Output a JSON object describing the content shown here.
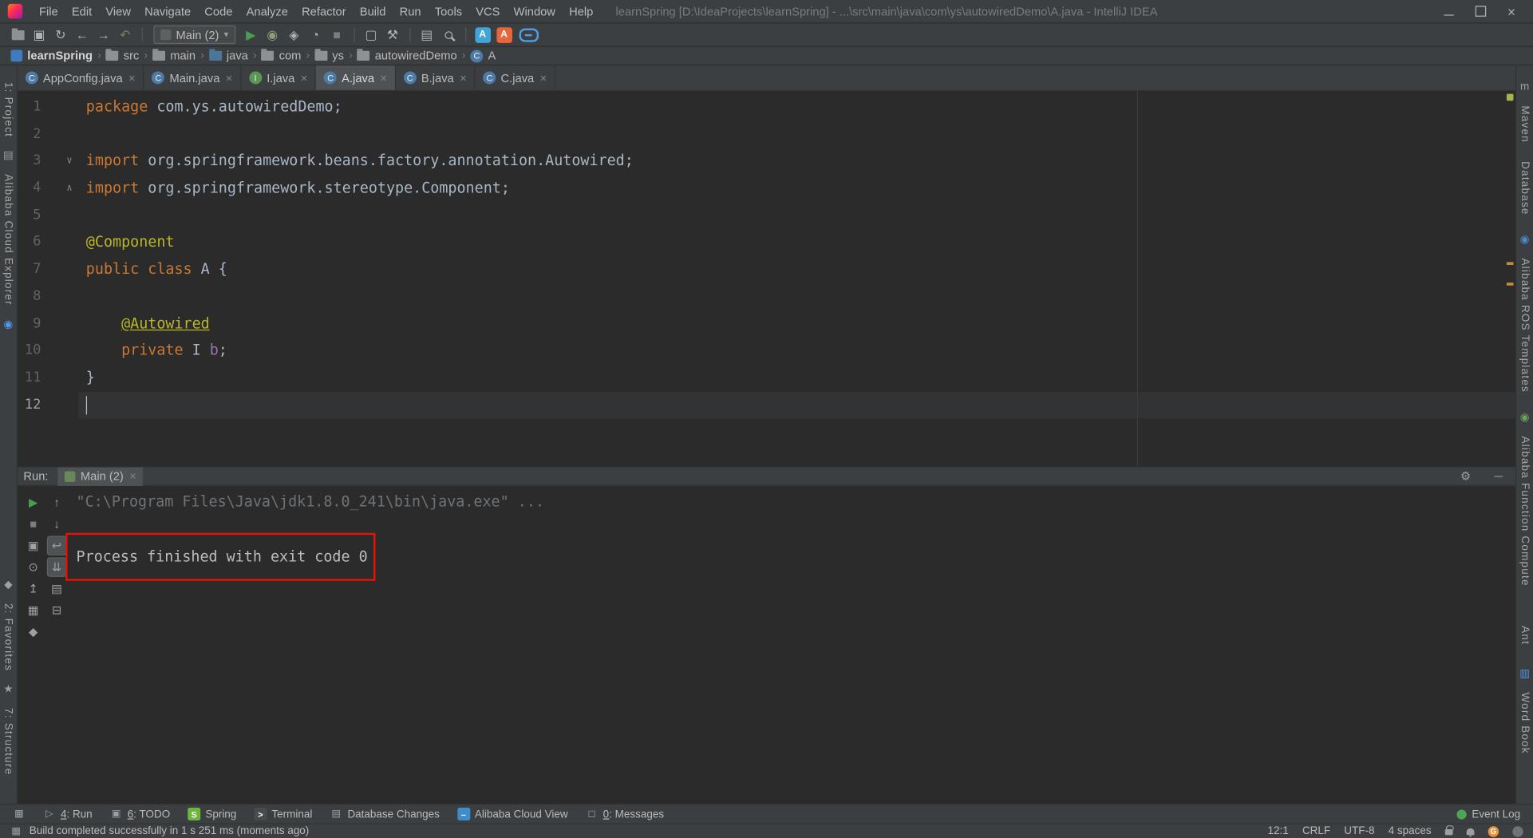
{
  "glyphs": {
    "close": "×",
    "window_close": "×",
    "gear": "⚙",
    "hide": "─",
    "dropdown": "▾",
    "breadcrumb_sep": "›",
    "grid": "▦"
  },
  "colors": {
    "keyword": "#cc7832",
    "plain": "#a9b7c6",
    "annotation": "#bbb529",
    "field": "#9876aa",
    "run_green": "#499c54",
    "annotation_box": "#df1508",
    "error_stripe_mark": "#bd8d3a",
    "inspection_indicator": "#a5b44b"
  },
  "titlebar": {
    "menu": [
      "File",
      "Edit",
      "View",
      "Navigate",
      "Code",
      "Analyze",
      "Refactor",
      "Build",
      "Run",
      "Tools",
      "VCS",
      "Window",
      "Help"
    ],
    "title": "learnSpring [D:\\IdeaProjects\\learnSpring] - ...\\src\\main\\java\\com\\ys\\autowiredDemo\\A.java - IntelliJ IDEA"
  },
  "toolbar": {
    "buttons": [
      {
        "name": "open",
        "type": "folder"
      },
      {
        "name": "save-all",
        "g": "▣"
      },
      {
        "name": "synchronize",
        "g": "↻"
      },
      {
        "name": "back",
        "g": "←"
      },
      {
        "name": "forward",
        "g": "→"
      },
      {
        "name": "undo",
        "g": "↶",
        "c": "#6a8759"
      },
      {
        "type": "sep"
      },
      {
        "type": "run-config",
        "label": "Main (2)"
      },
      {
        "name": "run",
        "g": "▶",
        "c": "#499c54"
      },
      {
        "name": "debug",
        "g": "◉",
        "c": "#8a9f79"
      },
      {
        "name": "run-with-coverage",
        "g": "◈"
      },
      {
        "name": "profiler",
        "g": "◔"
      },
      {
        "name": "stop",
        "g": "■",
        "c": "#7d7d7d"
      },
      {
        "type": "sep"
      },
      {
        "name": "attach-to-process",
        "g": "▢"
      },
      {
        "name": "build-project",
        "g": "⚒"
      },
      {
        "type": "sep"
      },
      {
        "name": "editor-layout",
        "g": "▤"
      },
      {
        "type": "search"
      },
      {
        "type": "sep"
      },
      {
        "name": "cloud-toolkit",
        "badge": "#41a4d6",
        "g": "A"
      },
      {
        "name": "aliyun-plugin",
        "badge": "#e8663c",
        "g": "A"
      },
      {
        "name": "alibaba-cloud",
        "type": "alicloud"
      }
    ]
  },
  "breadcrumbs": {
    "items": [
      {
        "label": "learnSpring",
        "icon": "project"
      },
      {
        "label": "src",
        "icon": "folder"
      },
      {
        "label": "main",
        "icon": "folder"
      },
      {
        "label": "java",
        "icon": "folder-source"
      },
      {
        "label": "com",
        "icon": "folder"
      },
      {
        "label": "ys",
        "icon": "folder"
      },
      {
        "label": "autowiredDemo",
        "icon": "folder"
      },
      {
        "label": "A",
        "icon": "class"
      }
    ]
  },
  "tabs": [
    {
      "label": "AppConfig.java",
      "icon": "class",
      "active": false
    },
    {
      "label": "Main.java",
      "icon": "class",
      "active": false
    },
    {
      "label": "I.java",
      "icon": "interface",
      "active": false
    },
    {
      "label": "A.java",
      "icon": "class",
      "active": true
    },
    {
      "label": "B.java",
      "icon": "class",
      "active": false
    },
    {
      "label": "C.java",
      "icon": "class",
      "active": false
    }
  ],
  "editor": {
    "caret": "12:1",
    "lines": [
      {
        "n": 1,
        "seg": [
          [
            "k",
            "package"
          ],
          [
            "p",
            " com.ys.autowiredDemo;"
          ]
        ]
      },
      {
        "n": 2,
        "seg": []
      },
      {
        "n": 3,
        "fold": "∨",
        "seg": [
          [
            "k",
            "import"
          ],
          [
            "p",
            " org.springframework.beans.factory.annotation.Autowired;"
          ]
        ]
      },
      {
        "n": 4,
        "fold": "∧",
        "seg": [
          [
            "k",
            "import"
          ],
          [
            "p",
            " org.springframework.stereotype.Component;"
          ]
        ]
      },
      {
        "n": 5,
        "seg": []
      },
      {
        "n": 6,
        "seg": [
          [
            "a",
            "@Component"
          ]
        ]
      },
      {
        "n": 7,
        "seg": [
          [
            "k",
            "public"
          ],
          [
            "p",
            " "
          ],
          [
            "k",
            "class"
          ],
          [
            "p",
            " A {"
          ]
        ]
      },
      {
        "n": 8,
        "seg": []
      },
      {
        "n": 9,
        "seg": [
          [
            "p",
            "    "
          ],
          [
            "au",
            "@Autowired"
          ]
        ]
      },
      {
        "n": 10,
        "seg": [
          [
            "p",
            "    "
          ],
          [
            "k",
            "private"
          ],
          [
            "p",
            " I "
          ],
          [
            "f",
            "b"
          ],
          [
            "p",
            ";"
          ]
        ]
      },
      {
        "n": 11,
        "seg": [
          [
            "p",
            "}"
          ]
        ]
      },
      {
        "n": 12,
        "seg": [],
        "caret": true
      }
    ]
  },
  "run_panel": {
    "label": "Run:",
    "tab": "Main (2)",
    "toolbar": [
      [
        {
          "name": "rerun-icon",
          "g": "▶",
          "c": "#499c54"
        },
        {
          "name": "up-stack-trace-icon",
          "g": "↑"
        }
      ],
      [
        {
          "name": "stop-icon",
          "g": "■",
          "c": "#7d7d7d"
        },
        {
          "name": "down-stack-trace-icon",
          "g": "↓"
        }
      ],
      [
        {
          "name": "dump-threads-icon",
          "g": "▣"
        },
        {
          "name": "soft-wrap-icon",
          "g": "↩",
          "sel": true
        }
      ],
      [
        {
          "name": "console-settings-icon",
          "g": "⊙"
        },
        {
          "name": "scroll-to-end-icon",
          "g": "⇊",
          "sel": true
        }
      ],
      [
        {
          "name": "import-dump-icon",
          "g": "↥"
        },
        {
          "name": "print-icon",
          "g": "▤"
        }
      ],
      [
        {
          "name": "restore-layout-icon",
          "g": "▦"
        },
        {
          "name": "clear-console-icon",
          "g": "⊟"
        }
      ],
      [
        {
          "name": "pin-tab-icon",
          "g": "◆"
        },
        null
      ]
    ],
    "console": [
      {
        "text": "\"C:\\Program Files\\Java\\jdk1.8.0_241\\bin\\java.exe\" ...",
        "style": "dim"
      },
      {
        "text": "",
        "style": "normal"
      },
      {
        "text": "Process finished with exit code 0",
        "style": "normal"
      }
    ]
  },
  "left_stripe": [
    {
      "t": "label",
      "text": "1: Project",
      "name": "toolwindow-project"
    },
    {
      "t": "icon",
      "g": "▤",
      "name": "project-tree-icon"
    },
    {
      "t": "label",
      "text": "Alibaba Cloud Explorer",
      "name": "toolwindow-alibaba-cloud-explorer"
    },
    {
      "t": "icon",
      "g": "◉",
      "c": "#5394ec",
      "name": "alibaba-cloud-explorer-icon"
    },
    {
      "t": "spacer"
    },
    {
      "t": "icon",
      "g": "◆",
      "name": "pin-icon"
    },
    {
      "t": "label",
      "text": "2: Favorites",
      "name": "toolwindow-favorites"
    },
    {
      "t": "icon",
      "g": "★",
      "name": "favorites-star-icon"
    },
    {
      "t": "label",
      "text": "7: Structure",
      "name": "toolwindow-structure"
    },
    {
      "t": "gap",
      "h": 14
    }
  ],
  "right_stripe": [
    {
      "t": "icon",
      "g": "m",
      "name": "maven-icon"
    },
    {
      "t": "label",
      "text": "Maven",
      "name": "toolwindow-maven"
    },
    {
      "t": "label",
      "text": "Database",
      "name": "toolwindow-database",
      "mt": 12
    },
    {
      "t": "icon",
      "g": "◉",
      "c": "#4a88c7",
      "name": "alibaba-ros-icon",
      "mt": 12
    },
    {
      "t": "label",
      "text": "Alibaba ROS Templates",
      "name": "toolwindow-alibaba-ros-templates"
    },
    {
      "t": "icon",
      "g": "◉",
      "c": "#67a25c",
      "name": "alibaba-function-compute-icon",
      "mt": 12
    },
    {
      "t": "label",
      "text": "Alibaba Function Compute",
      "name": "toolwindow-alibaba-function-compute"
    },
    {
      "t": "label",
      "text": "Ant",
      "name": "toolwindow-ant",
      "mt": 34
    },
    {
      "t": "spacer"
    },
    {
      "t": "icon",
      "g": "▥",
      "c": "#5394ec",
      "name": "word-book-icon"
    },
    {
      "t": "label",
      "text": "Word Book",
      "name": "toolwindow-word-book"
    },
    {
      "t": "gap",
      "h": 36
    }
  ],
  "bottom_bar": {
    "left": [
      {
        "name": "toolwindow-switcher",
        "icon": "grid",
        "ig": "▦"
      },
      {
        "name": "toolwindow-run",
        "icon": "run",
        "ig": "▷",
        "label": "4: Run",
        "mn": "4"
      },
      {
        "name": "toolwindow-todo",
        "icon": "todo",
        "ig": "▣",
        "label": "6: TODO",
        "mn": "6"
      },
      {
        "name": "toolwindow-spring",
        "icon": "spring",
        "ig": "S",
        "ibg": "#6db33f",
        "label": "Spring"
      },
      {
        "name": "toolwindow-terminal",
        "icon": "terminal",
        "ig": ">",
        "ibg": "#474b4d",
        "label": "Terminal"
      },
      {
        "name": "toolwindow-database-changes",
        "icon": "db",
        "ig": "▤",
        "label": "Database Changes"
      },
      {
        "name": "toolwindow-alibaba-cloud-view",
        "icon": "alicloud",
        "ig": "–",
        "ibg": "#3f8ccb",
        "label": "Alibaba Cloud View"
      },
      {
        "name": "toolwindow-messages",
        "icon": "messages",
        "ig": "◻",
        "label": "0: Messages",
        "mn": "0"
      }
    ],
    "right": [
      {
        "name": "event-log",
        "icon": "eventlog",
        "ig": "",
        "ibg": "#4da653",
        "label": "Event Log"
      }
    ]
  },
  "status_bar": {
    "message": "Build completed successfully in 1 s 251 ms (moments ago)",
    "caret": "12:1",
    "line_separator": "CRLF",
    "encoding": "UTF-8",
    "indent": "4 spaces",
    "g_badge": "G"
  }
}
